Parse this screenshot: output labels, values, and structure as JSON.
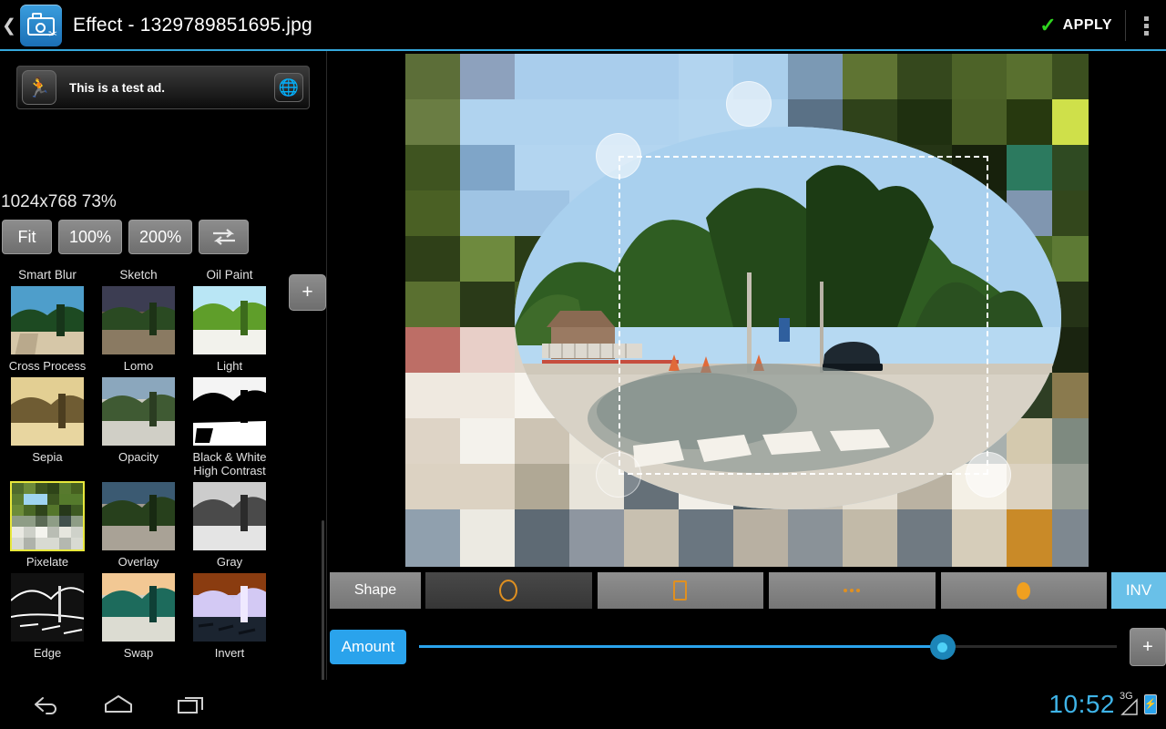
{
  "titlebar": {
    "back_icon": "chevron-left-icon",
    "app_icon": "photo-editor-icon",
    "title": "Effect - 1329789851695.jpg",
    "apply_label": "APPLY",
    "check_icon": "check-icon",
    "overflow_icon": "overflow-menu-icon",
    "accent_color": "#35a8dc"
  },
  "sidebar": {
    "ad": {
      "icon": "runner-icon",
      "text": "This is a test ad.",
      "action_icon": "globe-icon"
    },
    "image_info": "1024x768 73%",
    "zoom_buttons": [
      {
        "label": "Fit",
        "name": "zoom-fit-button"
      },
      {
        "label": "100%",
        "name": "zoom-100-button"
      },
      {
        "label": "200%",
        "name": "zoom-200-button"
      },
      {
        "label": "",
        "name": "compare-toggle-button",
        "icon": "compare-arrows-icon"
      }
    ],
    "add_effect_label": "+",
    "effects_top_row": [
      "Smart Blur",
      "Sketch",
      "Oil Paint"
    ],
    "effects": [
      {
        "label": "Cross Process",
        "selected": false
      },
      {
        "label": "Lomo",
        "selected": false
      },
      {
        "label": "Light",
        "selected": false
      },
      {
        "label": "Sepia",
        "selected": false
      },
      {
        "label": "Opacity",
        "selected": false
      },
      {
        "label": "Black & White\nHigh Contrast",
        "selected": false
      },
      {
        "label": "Pixelate",
        "selected": true
      },
      {
        "label": "Overlay",
        "selected": false
      },
      {
        "label": "Gray",
        "selected": false
      },
      {
        "label": "Edge",
        "selected": false
      },
      {
        "label": "Swap",
        "selected": false
      },
      {
        "label": "Invert",
        "selected": false
      }
    ],
    "selected_effect": "Pixelate",
    "selection_color": "#e8e83c"
  },
  "canvas": {
    "name": "image-preview-canvas",
    "description": "Pixelated photo of a tree-lined street with a crosswalk and a parked car",
    "selection_shape": "rectangle-dashed",
    "handles": [
      "top-left",
      "top-center",
      "bottom-left",
      "bottom-right"
    ]
  },
  "shape_toolbar": {
    "label": "Shape",
    "options": [
      {
        "icon": "ellipse-outline-icon",
        "active": true
      },
      {
        "icon": "rectangle-outline-icon",
        "active": false
      },
      {
        "icon": "dots-icon",
        "active": false
      },
      {
        "icon": "filled-ellipse-icon",
        "active": false
      }
    ],
    "invert_label": "INV",
    "invert_color": "#69c0e8",
    "icon_color": "#e09020"
  },
  "amount": {
    "label": "Amount",
    "value_percent": 75,
    "plus_label": "+",
    "accent_color": "#2aa3ec"
  },
  "navbar": {
    "back_icon": "back-icon",
    "home_icon": "home-icon",
    "recents_icon": "recents-icon",
    "clock": "10:52",
    "network": "3G",
    "signal_icon": "signal-icon",
    "battery_icon": "battery-charging-icon",
    "clock_color": "#3fb4e8"
  }
}
